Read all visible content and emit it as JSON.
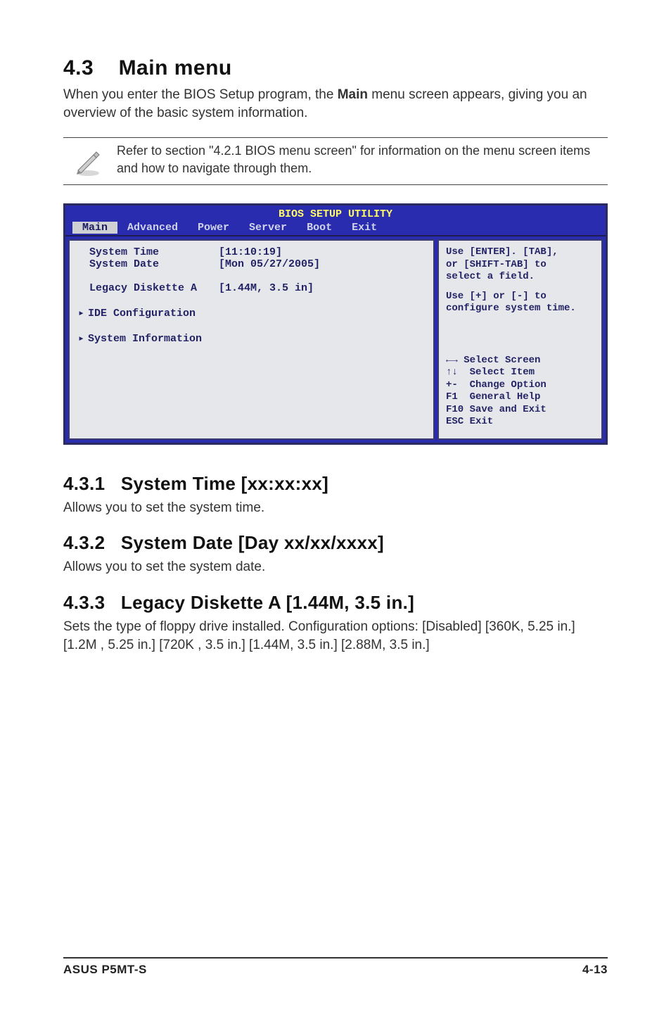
{
  "heading": {
    "num": "4.3",
    "title": "Main menu"
  },
  "lead": {
    "pre": "When you enter the BIOS Setup program, the ",
    "bold": "Main",
    "post": " menu screen appears, giving you an overview of the basic system information."
  },
  "note": "Refer to section \"4.2.1  BIOS menu screen\" for information on the menu screen items and how to navigate through them.",
  "bios": {
    "title": "BIOS SETUP UTILITY",
    "tabs": [
      "Main",
      "Advanced",
      "Power",
      "Server",
      "Boot",
      "Exit"
    ],
    "selected_tab": "Main",
    "rows": [
      {
        "label": "System Time",
        "value": "[11:10:19]",
        "arrow": false
      },
      {
        "label": "System Date",
        "value": "[Mon 05/27/2005]",
        "arrow": false
      },
      {
        "label": "",
        "value": "",
        "arrow": false
      },
      {
        "label": "Legacy Diskette A",
        "value": "[1.44M, 3.5 in]",
        "arrow": false
      },
      {
        "label": "",
        "value": "",
        "arrow": false
      },
      {
        "label": "IDE Configuration",
        "value": "",
        "arrow": true
      },
      {
        "label": "",
        "value": "",
        "arrow": false
      },
      {
        "label": "System Information",
        "value": "",
        "arrow": true
      }
    ],
    "help": {
      "l1": "Use [ENTER]. [TAB],",
      "l2": "or [SHIFT-TAB] to",
      "l3": "select a field.",
      "l4": "Use [+] or [-] to",
      "l5": "configure system time."
    },
    "keys": {
      "k1": "Select Screen",
      "k2": "Select Item",
      "k3": "+-  Change Option",
      "k4": "F1  General Help",
      "k5": "F10 Save and Exit",
      "k6": "ESC Exit"
    }
  },
  "sections": [
    {
      "num": "4.3.1",
      "title": "System Time [xx:xx:xx]",
      "body": "Allows you to set the system time."
    },
    {
      "num": "4.3.2",
      "title": "System Date [Day xx/xx/xxxx]",
      "body": "Allows you to set the system date."
    },
    {
      "num": "4.3.3",
      "title": "Legacy Diskette A [1.44M, 3.5 in.]",
      "body": "Sets the type of floppy drive installed. Configuration options: [Disabled] [360K, 5.25 in.] [1.2M , 5.25 in.] [720K , 3.5 in.] [1.44M, 3.5 in.] [2.88M, 3.5 in.]"
    }
  ],
  "footer": {
    "left": "ASUS P5MT-S",
    "right": "4-13"
  }
}
